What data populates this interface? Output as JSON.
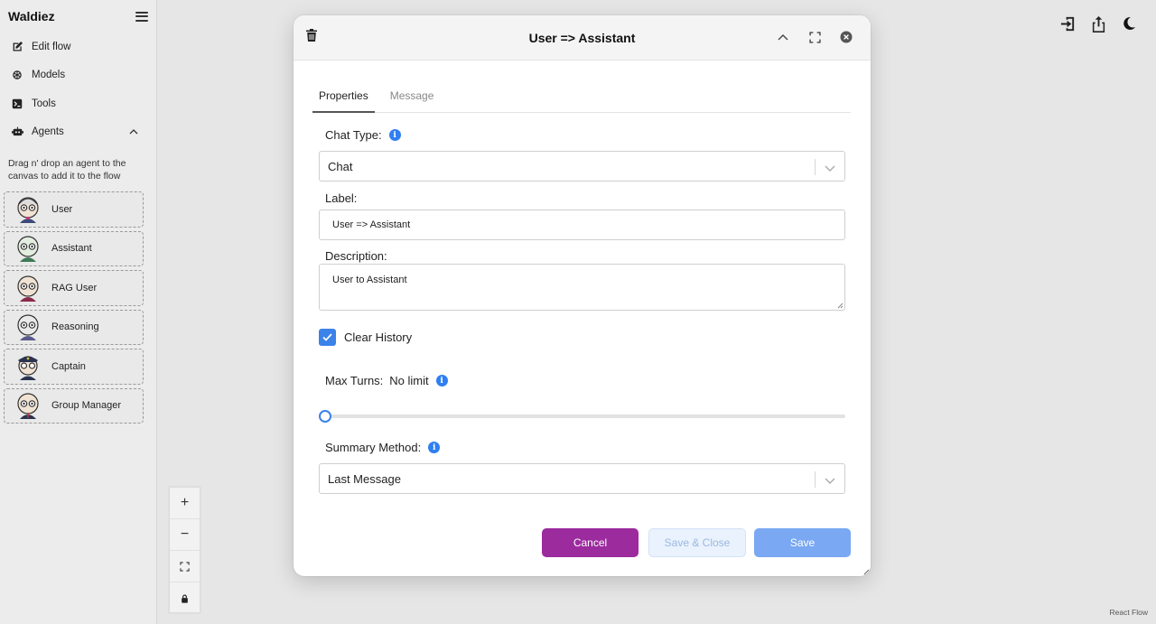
{
  "sidebar": {
    "brand": "Waldiez",
    "nav": [
      {
        "label": "Edit flow",
        "icon": "edit-icon"
      },
      {
        "label": "Models",
        "icon": "models-icon"
      },
      {
        "label": "Tools",
        "icon": "terminal-icon"
      },
      {
        "label": "Agents",
        "icon": "robot-icon"
      }
    ],
    "hint": "Drag n' drop an agent to the canvas to add it to the flow",
    "agents": [
      {
        "label": "User"
      },
      {
        "label": "Assistant"
      },
      {
        "label": "RAG User"
      },
      {
        "label": "Reasoning"
      },
      {
        "label": "Captain"
      },
      {
        "label": "Group Manager"
      }
    ]
  },
  "canvas": {
    "controls": [
      "+",
      "−"
    ],
    "attribution": "React Flow"
  },
  "modal": {
    "title": "User => Assistant",
    "tabs": [
      "Properties",
      "Message"
    ],
    "chat_type_label": "Chat Type:",
    "chat_type_value": "Chat",
    "label_label": "Label:",
    "label_value": "User => Assistant",
    "description_label": "Description:",
    "description_value": "User to Assistant",
    "clear_history_label": "Clear History",
    "clear_history_checked": true,
    "max_turns_label": "Max Turns:",
    "max_turns_value": "No limit",
    "max_turns_slider_fraction": 0,
    "summary_method_label": "Summary Method:",
    "summary_method_value": "Last Message",
    "buttons": {
      "cancel": "Cancel",
      "save_close": "Save & Close",
      "save": "Save"
    }
  },
  "colors": {
    "accent_blue": "#3b82e9",
    "cancel_purple": "#9c2b9e",
    "info_blue": "#2f7ff0"
  }
}
